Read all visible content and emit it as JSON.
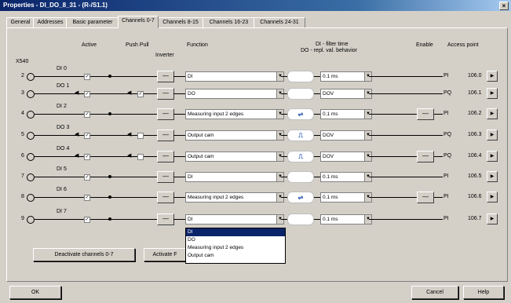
{
  "window": {
    "title": "Properties - DI_DO_8_31 - (R-/S1.1)",
    "close": "×"
  },
  "tabs": [
    "General",
    "Addresses",
    "Basic parameter",
    "Channels 0-7",
    "Channels 8-15",
    "Channels 16-23",
    "Channels 24-31"
  ],
  "active_tab_index": 3,
  "headers": {
    "connector": "X540",
    "active": "Active",
    "push_pull": "Push Pull",
    "inverter": "Inverter",
    "function": "Function",
    "filter_1": "DI - filter time",
    "filter_2": "DO - repl. val. behavior",
    "enable": "Enable",
    "access_point": "Access point"
  },
  "channels": [
    {
      "terminal": "2",
      "name": "DI 0",
      "direction": "in",
      "push_pull": false,
      "function": "DI",
      "filter": "0.1 ms",
      "filter_icon": "",
      "enable": false,
      "ap": "PI",
      "addr": "106.0"
    },
    {
      "terminal": "3",
      "name": "DO 1",
      "direction": "out",
      "push_pull": true,
      "function": "DO",
      "filter": "DOV",
      "filter_icon": "",
      "enable": false,
      "ap": "PQ",
      "addr": "106.1"
    },
    {
      "terminal": "4",
      "name": "DI 2",
      "direction": "in",
      "push_pull": false,
      "function": "Measuring input 2 edges",
      "filter": "0.1 ms",
      "filter_icon": "edges",
      "enable": true,
      "ap": "PI",
      "addr": "106.2"
    },
    {
      "terminal": "5",
      "name": "DO 3",
      "direction": "out",
      "push_pull": false,
      "function": "Output cam",
      "filter": "DOV",
      "filter_icon": "cam",
      "enable": false,
      "ap": "PQ",
      "addr": "106.3"
    },
    {
      "terminal": "6",
      "name": "DO 4",
      "direction": "out",
      "push_pull": false,
      "function": "Output cam",
      "filter": "DOV",
      "filter_icon": "cam",
      "enable": true,
      "ap": "PQ",
      "addr": "106.4"
    },
    {
      "terminal": "7",
      "name": "DI 5",
      "direction": "in",
      "push_pull": false,
      "function": "DI",
      "filter": "0.1 ms",
      "filter_icon": "",
      "enable": false,
      "ap": "PI",
      "addr": "106.5"
    },
    {
      "terminal": "8",
      "name": "DI 6",
      "direction": "in",
      "push_pull": false,
      "function": "Measuring input 2 edges",
      "filter": "0.1 ms",
      "filter_icon": "edges",
      "enable": true,
      "ap": "PI",
      "addr": "106.6"
    },
    {
      "terminal": "9",
      "name": "DI 7",
      "direction": "in",
      "push_pull": false,
      "function": "DI",
      "filter": "0.1 ms",
      "filter_icon": "",
      "enable": false,
      "ap": "PI",
      "addr": "106.7"
    }
  ],
  "function_dropdown": {
    "options": [
      "DI",
      "DO",
      "Measuring input 2 edges",
      "Output cam"
    ],
    "selected": "DI"
  },
  "buttons": {
    "deactivate": "Deactivate channels 0-7",
    "activate": "Activate F",
    "ok": "OK",
    "cancel": "Cancel",
    "help": "Help"
  }
}
